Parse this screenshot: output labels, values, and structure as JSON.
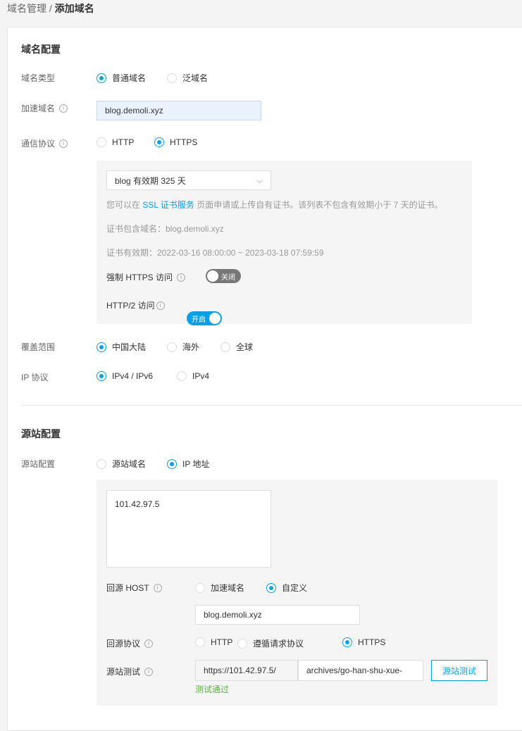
{
  "breadcrumb": {
    "parent": "域名管理",
    "sep": "/",
    "current": "添加域名"
  },
  "domain_config": {
    "title": "域名配置",
    "type": {
      "label": "域名类型",
      "options": [
        "普通域名",
        "泛域名"
      ],
      "selected": 0
    },
    "accel": {
      "label": "加速域名",
      "value": "blog.demoli.xyz"
    },
    "protocol": {
      "label": "通信协议",
      "options": [
        "HTTP",
        "HTTPS"
      ],
      "selected": 1
    },
    "cert": {
      "select": "blog 有效期 325 天",
      "hint_pre": "您可以在",
      "hint_link": "SSL 证书服务",
      "hint_post": "页面申请或上传自有证书。该列表不包含有效期小于 7 天的证书。",
      "domains": "证书包含域名：blog.demoli.xyz",
      "validity": "证书有效期：2022-03-16 08:00:00 ~ 2023-03-18 07:59:59",
      "force_https": {
        "label": "强制 HTTPS 访问",
        "state": "关闭"
      },
      "http2": {
        "label": "HTTP/2 访问",
        "state": "开启"
      }
    },
    "coverage": {
      "label": "覆盖范围",
      "options": [
        "中国大陆",
        "海外",
        "全球"
      ],
      "selected": 0
    },
    "ip": {
      "label": "IP 协议",
      "options": [
        "IPv4 / IPv6",
        "IPv4"
      ],
      "selected": 0
    }
  },
  "origin_config": {
    "title": "源站配置",
    "type": {
      "label": "源站配置",
      "options": [
        "源站域名",
        "IP 地址"
      ],
      "selected": 1
    },
    "ips": "101.42.97.5",
    "host": {
      "label": "回源 HOST",
      "options": [
        "加速域名",
        "自定义"
      ],
      "selected": 1,
      "value": "blog.demoli.xyz"
    },
    "proto": {
      "label": "回源协议",
      "options": [
        "HTTP",
        "遵循请求协议",
        "HTTPS"
      ],
      "selected": 2
    },
    "test": {
      "label": "源站测试",
      "prefix": "https://101.42.97.5/",
      "path": "archives/go-han-shu-xue-",
      "button": "源站测试",
      "result": "测试通过"
    }
  },
  "colors": {
    "accent": "#0aa0e6",
    "success": "#4cb832"
  }
}
